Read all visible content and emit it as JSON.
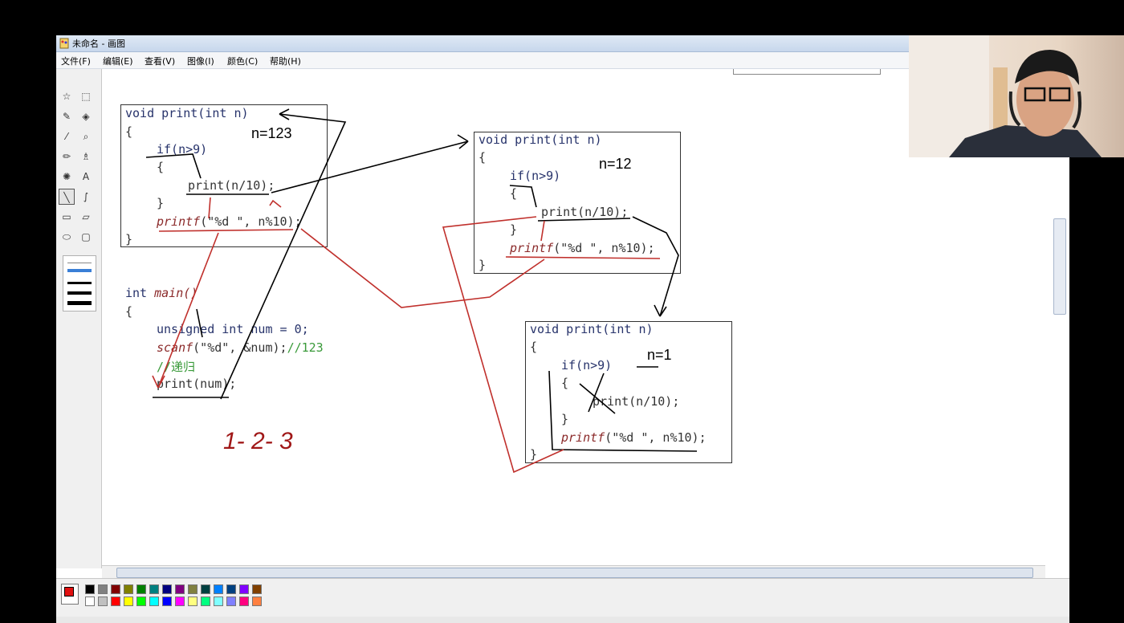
{
  "window": {
    "title": "未命名 - 画图"
  },
  "menu": [
    "文件(F)",
    "编辑(E)",
    "查看(V)",
    "图像(I)",
    "颜色(C)",
    "帮助(H)"
  ],
  "tools": [
    {
      "name": "free-select-icon",
      "glyph": "☆"
    },
    {
      "name": "rect-select-icon",
      "glyph": "⬚"
    },
    {
      "name": "eraser-icon",
      "glyph": "✎"
    },
    {
      "name": "fill-bucket-icon",
      "glyph": "◈"
    },
    {
      "name": "color-picker-icon",
      "glyph": "⁄"
    },
    {
      "name": "magnifier-icon",
      "glyph": "⌕"
    },
    {
      "name": "pencil-icon",
      "glyph": "✏"
    },
    {
      "name": "brush-icon",
      "glyph": "♗"
    },
    {
      "name": "airbrush-icon",
      "glyph": "✺"
    },
    {
      "name": "text-tool-icon",
      "glyph": "A"
    },
    {
      "name": "line-tool-icon",
      "glyph": "╲"
    },
    {
      "name": "curve-tool-icon",
      "glyph": "∫"
    },
    {
      "name": "rectangle-tool-icon",
      "glyph": "▭"
    },
    {
      "name": "polygon-tool-icon",
      "glyph": "▱"
    },
    {
      "name": "ellipse-tool-icon",
      "glyph": "⬭"
    },
    {
      "name": "rounded-rect-tool-icon",
      "glyph": "▢"
    }
  ],
  "code": {
    "box1": {
      "l1": "void print(int n)",
      "l2": "{",
      "l3": "if(n>9)",
      "l4": "{",
      "l5": "print(n/10);",
      "l6": "}",
      "l7a": "printf",
      "l7b": "(\"%d \", n%10);",
      "l8": "}"
    },
    "box2": {
      "l1": "void print(int n)",
      "l2": "{",
      "l3": "if(n>9)",
      "l4": "{",
      "l5": "print(n/10);",
      "l6": "}",
      "l7a": "printf",
      "l7b": "(\"%d \", n%10);",
      "l8": "}"
    },
    "box3": {
      "l1": "void print(int n)",
      "l2": "{",
      "l3": "if(n>9)",
      "l4": "{",
      "l5": "print(n/10);",
      "l6": "}",
      "l7a": "printf",
      "l7b": "(\"%d \", n%10);",
      "l8": "}"
    },
    "main": {
      "l1a": "int ",
      "l1b": "main()",
      "l2": "{",
      "l3": "unsigned int num = 0;",
      "l4a": "scanf",
      "l4b": "(\"%d\", &num);",
      "l4c": "//123",
      "l5": "//递归",
      "l6": "print(num);"
    }
  },
  "annotations": {
    "n1": "n=123",
    "n2": "n=12",
    "n3": "n=1",
    "seq": "1- 2- 3"
  },
  "palette": {
    "foreground": "#e11111",
    "row1": [
      "#000000",
      "#808080",
      "#800000",
      "#808000",
      "#008000",
      "#008080",
      "#000080",
      "#800080",
      "#808040",
      "#004040",
      "#0080ff",
      "#004080",
      "#8000ff",
      "#804000"
    ],
    "row2": [
      "#ffffff",
      "#c0c0c0",
      "#ff0000",
      "#ffff00",
      "#00ff00",
      "#00ffff",
      "#0000ff",
      "#ff00ff",
      "#ffff80",
      "#00ff80",
      "#80ffff",
      "#8080ff",
      "#ff0080",
      "#ff8040"
    ]
  },
  "colors": {
    "titlebar": "#c7d7ec",
    "annotation_red": "#c0302c",
    "annotation_black": "#000000"
  }
}
